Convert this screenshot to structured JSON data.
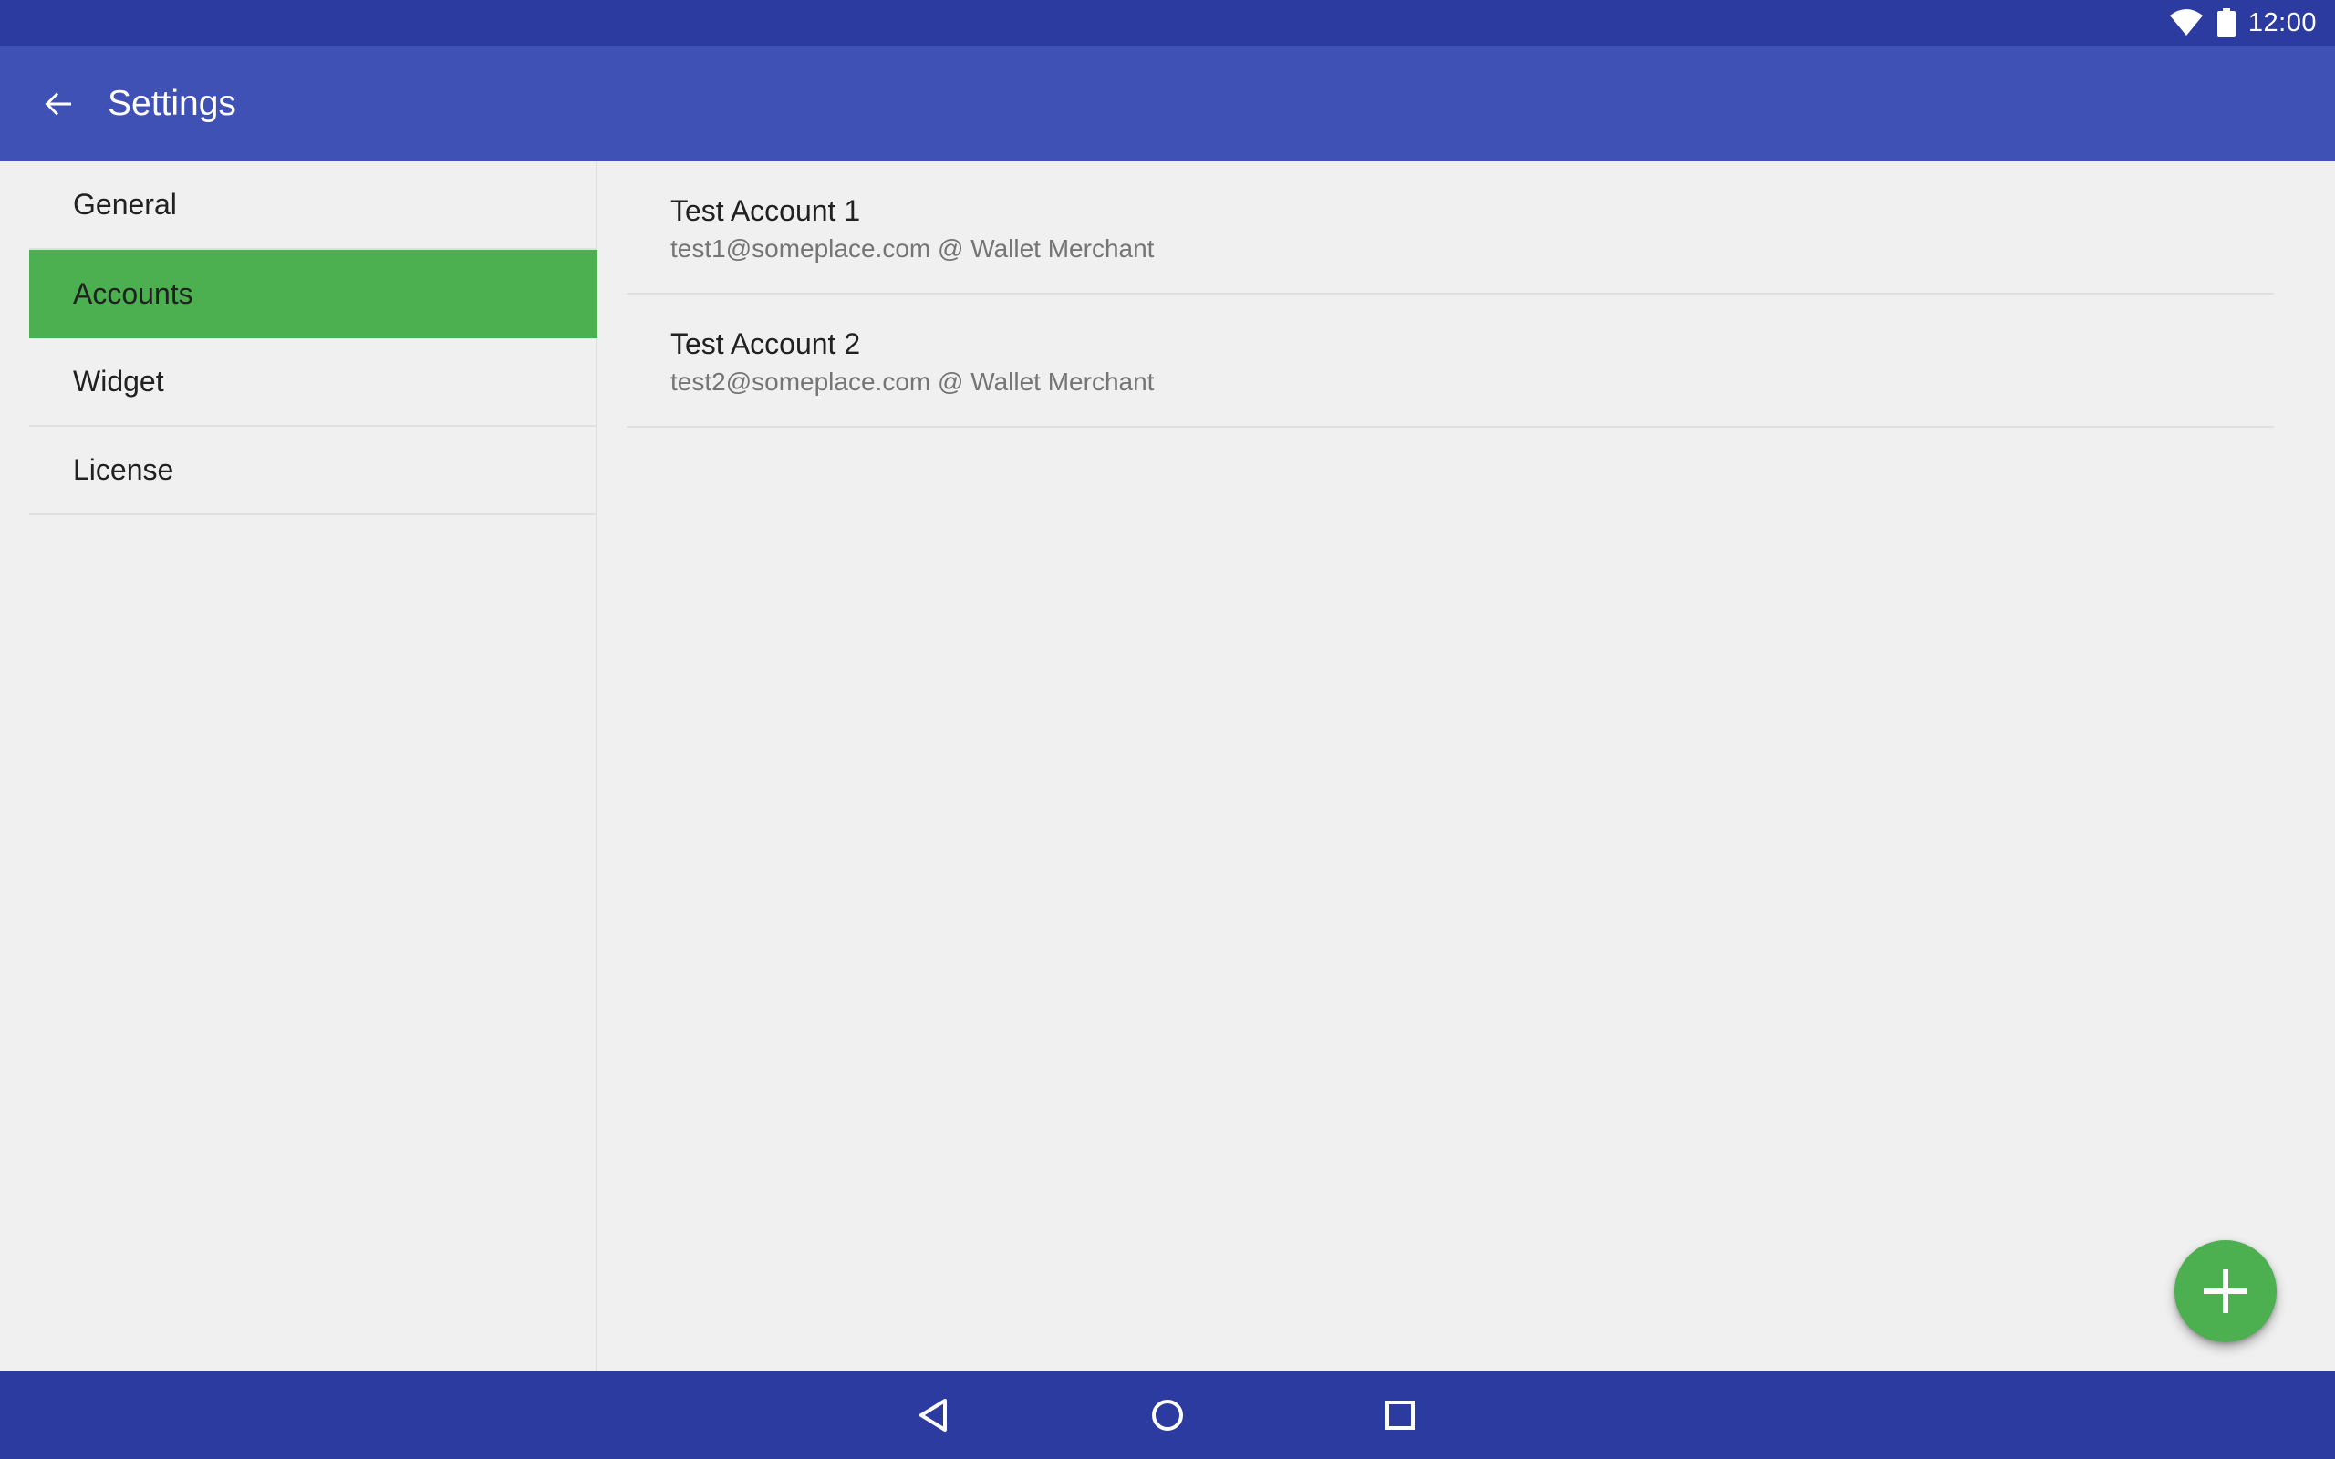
{
  "status_bar": {
    "time": "12:00",
    "icons": [
      "wifi-icon",
      "battery-icon"
    ]
  },
  "app_bar": {
    "title": "Settings",
    "back_icon": "arrow-left-icon"
  },
  "sidebar": {
    "items": [
      {
        "label": "General",
        "active": false
      },
      {
        "label": "Accounts",
        "active": true
      },
      {
        "label": "Widget",
        "active": false
      },
      {
        "label": "License",
        "active": false
      }
    ]
  },
  "accounts": [
    {
      "name": "Test Account 1",
      "detail": "test1@someplace.com @ Wallet Merchant"
    },
    {
      "name": "Test Account 2",
      "detail": "test2@someplace.com @ Wallet Merchant"
    }
  ],
  "fab": {
    "icon": "plus-icon"
  },
  "system_nav": {
    "icons": [
      "back-triangle-icon",
      "home-circle-icon",
      "recents-square-icon"
    ]
  },
  "colors": {
    "status_bar": "#2c3b9f",
    "app_bar": "#3f51b5",
    "accent": "#4caf50",
    "background": "#f0f0f0"
  }
}
